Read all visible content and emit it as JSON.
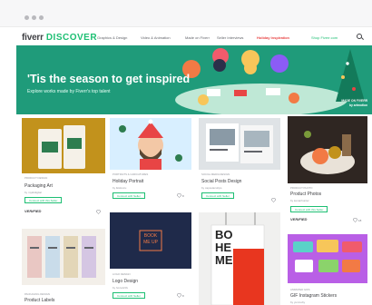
{
  "nav": {
    "logo": "fiverr",
    "logo_sub": "DISCOVER",
    "links": [
      "Graphics & Design",
      "Video & Animation",
      "Made on Fiverr",
      "Seller Interviews"
    ],
    "holiday": "Holiday Inspiration",
    "shop": "Shop Fiverr.com",
    "search_icon": "search-icon"
  },
  "hero": {
    "title": "'Tis the season to get inspired",
    "subtitle": "Explore works made by Fiverr's top talent",
    "credit": "MADE ON FIVERR by artmotion"
  },
  "cards": [
    {
      "tag": "PRODUCT DESIGN",
      "title": "Packaging Art",
      "by": "by mykitdigital",
      "button": "Connect with this Seller",
      "badge": "VERIFIED",
      "likes": ""
    },
    {
      "tag": "PORTRAITS & CARICATURES",
      "title": "Holiday Portrait",
      "by": "by lktsfenru",
      "button": "Connect with Seller",
      "badge": "",
      "likes": "8"
    },
    {
      "tag": "SOCIAL MEDIA DESIGN",
      "title": "Social Posts Design",
      "by": "by capsularstrips",
      "button": "Connect with Seller",
      "badge": "",
      "likes": ""
    },
    {
      "tag": "PRODUCT PHOTO",
      "title": "Product Photos",
      "by": "by kenanhunter",
      "button": "Connect with this Seller",
      "badge": "VERIFIED",
      "likes": "18"
    },
    {
      "tag": "PACKAGING DESIGN",
      "title": "Product Labels",
      "by": "by leafoil1000",
      "button": "",
      "badge": "",
      "likes": ""
    },
    {
      "tag": "LOGO DESIGN",
      "title": "Logo Design",
      "by": "by hoze123x",
      "button": "Connect with Seller",
      "badge": "",
      "likes": "8",
      "image_text": "BOOK ME UP"
    },
    {
      "tag": "",
      "title": "",
      "by": "",
      "button": "",
      "badge": "",
      "likes": "",
      "image_text": "BO HE ME"
    },
    {
      "tag": "ANIMATED GIFS",
      "title": "GIF Instagram Stickers",
      "by": "by yumnoby",
      "button": "",
      "badge": "",
      "likes": ""
    }
  ],
  "colors": {
    "brand_green": "#1dbf73",
    "hero_green": "#1f9b7a",
    "holiday_red": "#e84545"
  }
}
